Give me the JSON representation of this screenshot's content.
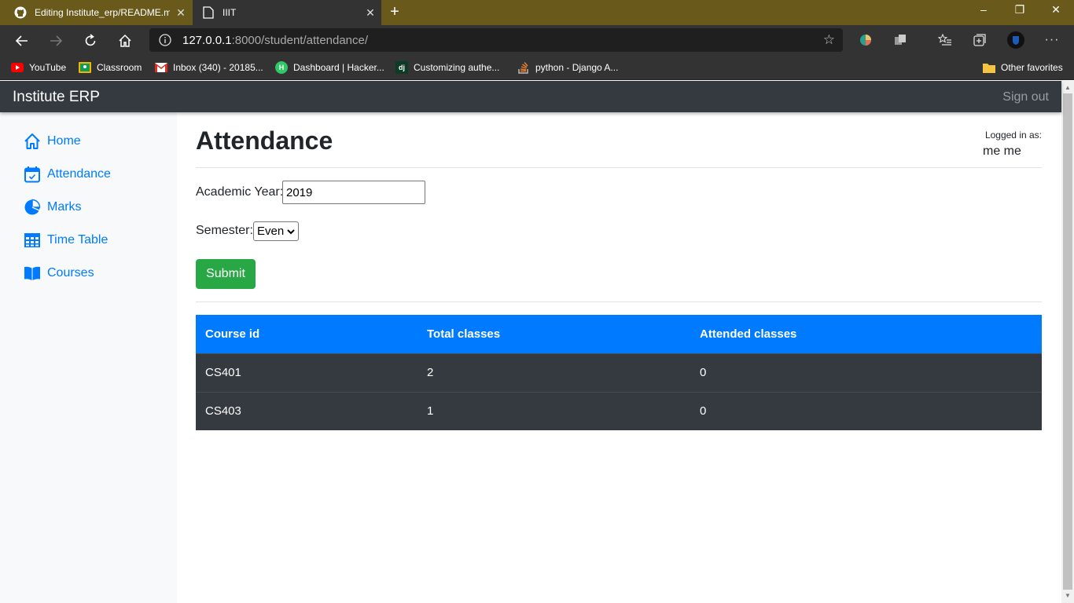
{
  "browser": {
    "tabs": [
      {
        "title": "Editing Institute_erp/README.md",
        "icon": "github-icon"
      },
      {
        "title": "IIIT",
        "icon": "page-icon"
      }
    ],
    "url_host": "127.0.0.1",
    "url_rest": ":8000/student/attendance/",
    "bookmarks": [
      {
        "label": "YouTube",
        "icon": "youtube-icon"
      },
      {
        "label": "Classroom",
        "icon": "classroom-icon"
      },
      {
        "label": "Inbox (340) - 20185...",
        "icon": "gmail-icon"
      },
      {
        "label": "Dashboard | Hacker...",
        "icon": "hackerrank-icon"
      },
      {
        "label": "Customizing authe...",
        "icon": "django-icon"
      },
      {
        "label": "python - Django A...",
        "icon": "stackoverflow-icon"
      }
    ],
    "other_favorites": "Other favorites"
  },
  "app": {
    "brand": "Institute ERP",
    "signout": "Sign out"
  },
  "sidebar": {
    "items": [
      {
        "label": "Home",
        "icon": "home-icon"
      },
      {
        "label": "Attendance",
        "icon": "calendar-icon"
      },
      {
        "label": "Marks",
        "icon": "pie-chart-icon"
      },
      {
        "label": "Time Table",
        "icon": "table-grid-icon"
      },
      {
        "label": "Courses",
        "icon": "book-icon"
      }
    ]
  },
  "main": {
    "title": "Attendance",
    "logged_in_label": "Logged in as:",
    "logged_in_user": "me me",
    "academic_year_label": "Academic Year:",
    "academic_year_value": "2019",
    "semester_label": "Semester:",
    "semester_value": "Even",
    "submit_label": "Submit"
  },
  "table": {
    "headers": [
      "Course id",
      "Total classes",
      "Attended classes"
    ],
    "rows": [
      [
        "CS401",
        "2",
        "0"
      ],
      [
        "CS403",
        "1",
        "0"
      ]
    ]
  },
  "colors": {
    "primary": "#007bff",
    "success": "#28a745",
    "dark": "#343a40",
    "titlebar": "#69591b"
  }
}
